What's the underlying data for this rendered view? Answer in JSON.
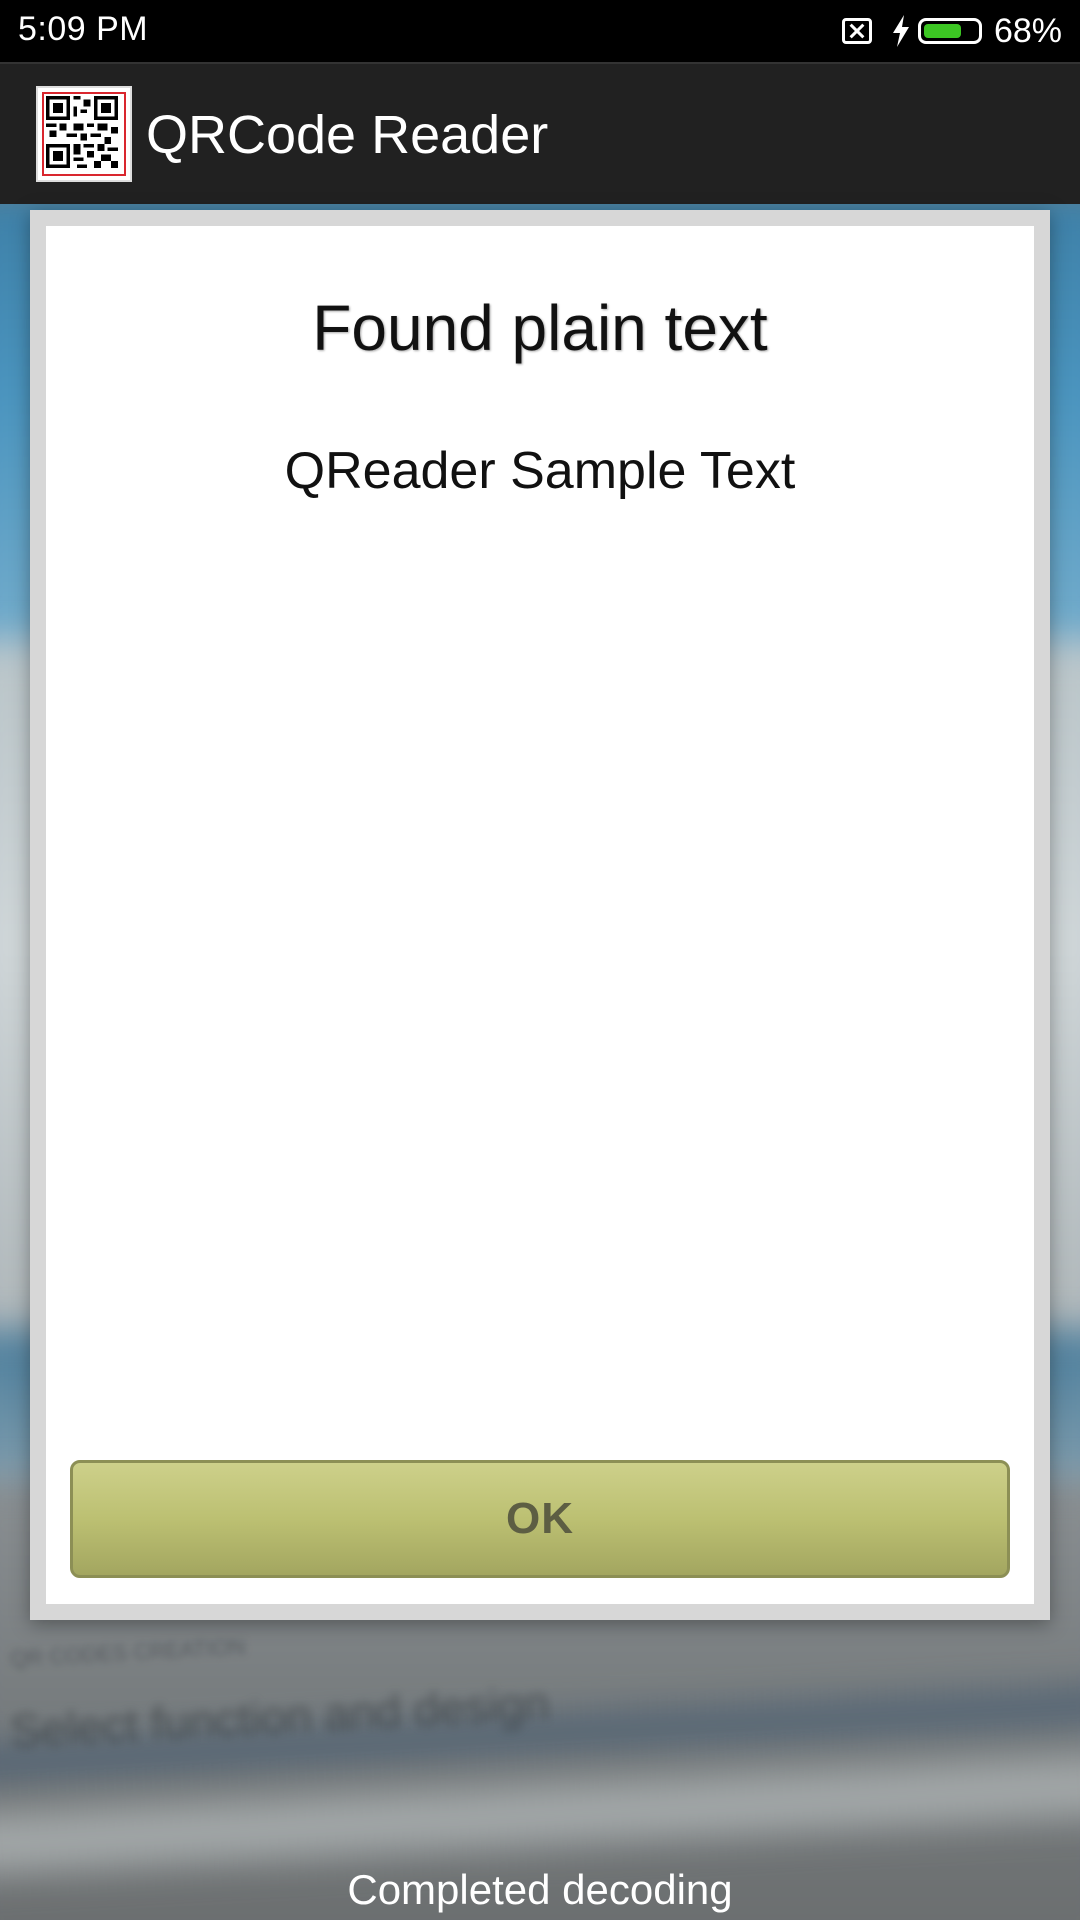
{
  "status_bar": {
    "time": "5:09  PM",
    "battery_percent": "68%",
    "battery_level": 0.68,
    "icons": [
      "sim-blocked-icon",
      "charging-bolt-icon",
      "battery-icon"
    ]
  },
  "app_bar": {
    "title": "QRCode Reader",
    "logo_icon": "qr-code-icon"
  },
  "dialog": {
    "title": "Found plain text",
    "content": "QReader Sample Text",
    "ok_label": "OK"
  },
  "footer": {
    "status": "Completed decoding"
  },
  "background_text": {
    "heading": "Select function and design",
    "small": "QR CODES CREATION"
  },
  "colors": {
    "app_bar": "#212121",
    "ok_button": "#bcc072",
    "battery_fill": "#3cc623",
    "logo_border": "#d9262e"
  }
}
